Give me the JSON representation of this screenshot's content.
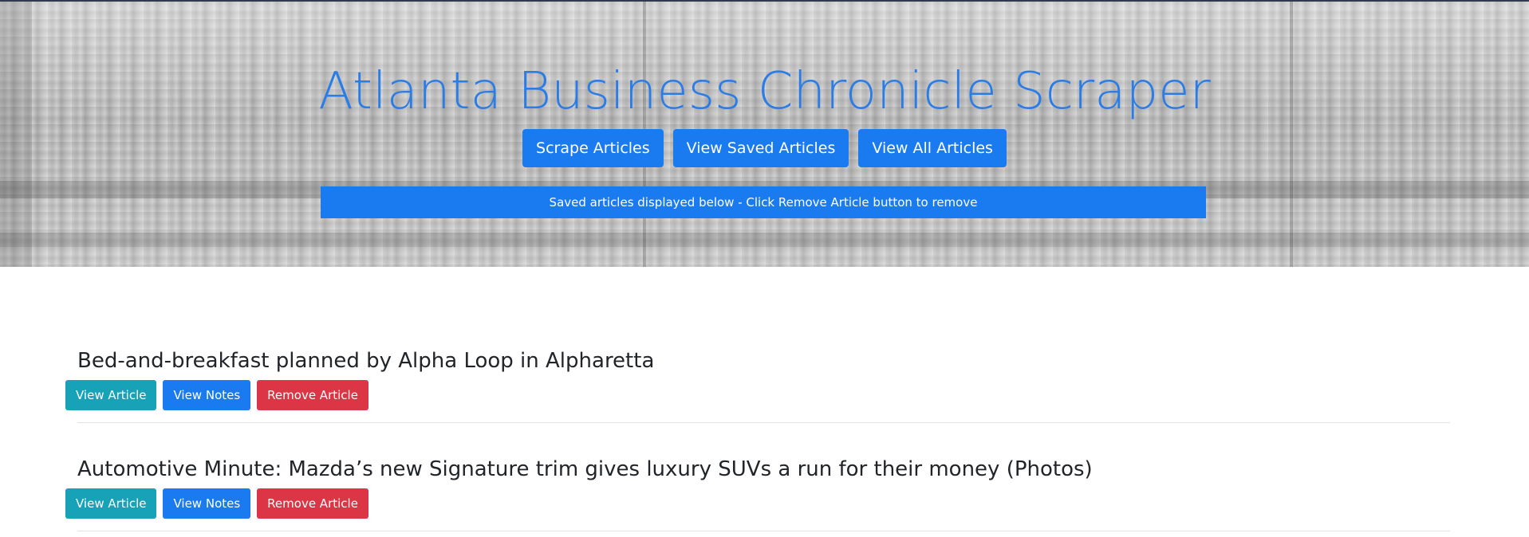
{
  "header": {
    "title": "Atlanta Business Chronicle Scraper",
    "buttons": {
      "scrape": "Scrape Articles",
      "saved": "View Saved Articles",
      "all": "View All Articles"
    },
    "banner": "Saved articles displayed below - Click Remove Article button to remove"
  },
  "articles": [
    {
      "title": "Bed-and-breakfast planned by Alpha Loop in Alpharetta",
      "view_article": "View Article",
      "view_notes": "View Notes",
      "remove_article": "Remove Article"
    },
    {
      "title": "Automotive Minute: Mazda’s new Signature trim gives luxury SUVs a run for their money (Photos)",
      "view_article": "View Article",
      "view_notes": "View Notes",
      "remove_article": "Remove Article"
    }
  ],
  "colors": {
    "primary": "#1a7bf0",
    "info": "#17a2b8",
    "danger": "#dc3545",
    "title": "#2a7de6"
  }
}
